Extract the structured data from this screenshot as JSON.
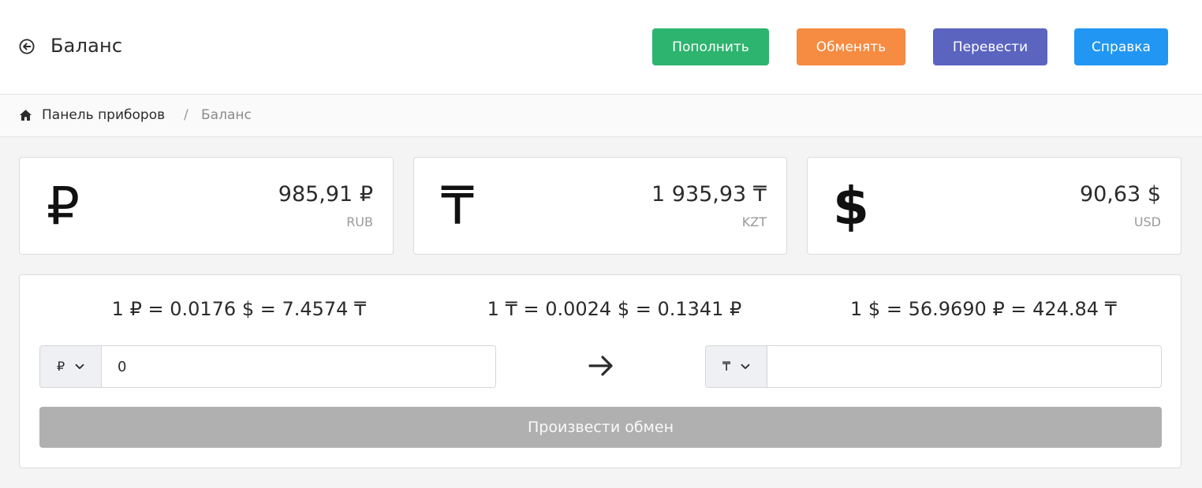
{
  "header": {
    "title": "Баланс",
    "buttons": {
      "topup": "Пополнить",
      "exchange": "Обменять",
      "transfer": "Перевести",
      "help": "Справка"
    }
  },
  "breadcrumb": {
    "items": [
      "Панель приборов",
      "Баланс"
    ],
    "separator": "/"
  },
  "balances": [
    {
      "symbol": "₽",
      "amount": "985,91 ₽",
      "code": "RUB"
    },
    {
      "symbol": "₸",
      "amount": "1 935,93 ₸",
      "code": "KZT"
    },
    {
      "symbol": "$",
      "amount": "90,63 $",
      "code": "USD"
    }
  ],
  "exchange": {
    "rates": [
      "1 ₽ = 0.0176 $ = 7.4574 ₸",
      "1 ₸ = 0.0024 $ = 0.1341 ₽",
      "1 $ = 56.9690 ₽ = 424.84 ₸"
    ],
    "from": {
      "currency": "₽",
      "value": "0"
    },
    "to": {
      "currency": "₸",
      "value": ""
    },
    "submit_label": "Произвести обмен"
  },
  "colors": {
    "topup": "#2db46e",
    "exchange": "#f68b42",
    "transfer": "#5b64bf",
    "help": "#2196f3",
    "disabled": "#b0b0b0"
  }
}
